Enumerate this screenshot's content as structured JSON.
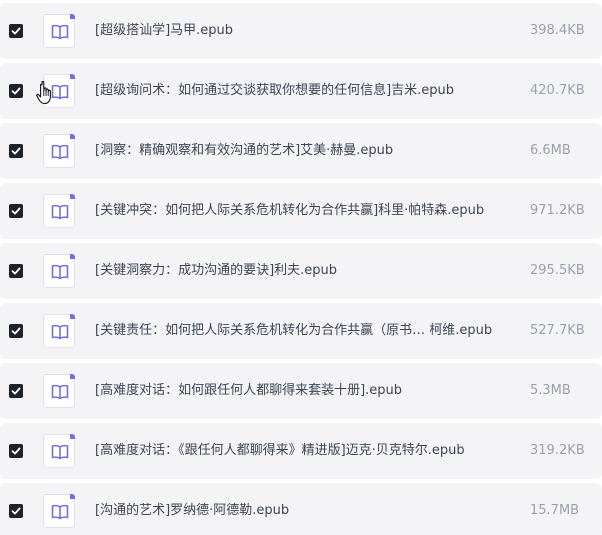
{
  "files": [
    {
      "name": "[超级搭讪学]马甲.epub",
      "size": "398.4KB",
      "checked": true
    },
    {
      "name": "[超级询问术：如何通过交谈获取你想要的任何信息]吉米.epub",
      "size": "420.7KB",
      "checked": true
    },
    {
      "name": "[洞察：精确观察和有效沟通的艺术]艾美·赫曼.epub",
      "size": "6.6MB",
      "checked": true
    },
    {
      "name": "[关键冲突：如何把人际关系危机转化为合作共赢]科里·帕特森.epub",
      "size": "971.2KB",
      "checked": true
    },
    {
      "name": "[关键洞察力：成功沟通的要诀]利夫.epub",
      "size": "295.5KB",
      "checked": true
    },
    {
      "name": "[关键责任：如何把人际关系危机转化为合作共赢（原书…  柯维.epub",
      "size": "527.7KB",
      "checked": true
    },
    {
      "name": "[高难度对话：如何跟任何人都聊得来套装十册].epub",
      "size": "5.3MB",
      "checked": true
    },
    {
      "name": "[高难度对话：《跟任何人都聊得来》精进版]迈克·贝克特尔.epub",
      "size": "319.2KB",
      "checked": true
    },
    {
      "name": "[沟通的艺术]罗纳德·阿德勒.epub",
      "size": "15.7MB",
      "checked": true
    }
  ],
  "icons": {
    "checkbox": "checkmark-icon",
    "file": "book-icon",
    "cursor": "hand-pointer-icon"
  },
  "colors": {
    "row_background": "#f4f4f7",
    "checkbox": "#1f2329",
    "file_icon_accent": "#6f6fe6",
    "file_name": "#3d4555",
    "file_size": "#9aa1ad"
  }
}
